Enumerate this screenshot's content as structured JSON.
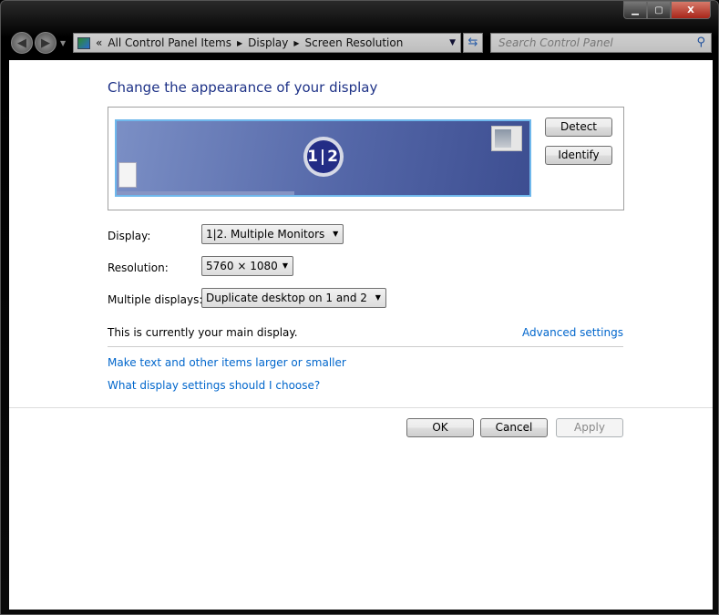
{
  "window": {
    "minimize_icon": "minimize-icon",
    "maximize_icon": "maximize-icon",
    "close_label": "X"
  },
  "address_bar": {
    "overflow": "«",
    "breadcrumbs": [
      "All Control Panel Items",
      "Display",
      "Screen Resolution"
    ]
  },
  "search": {
    "placeholder": "Search Control Panel"
  },
  "page": {
    "title": "Change the appearance of your display",
    "monitor_badge": "1|2",
    "detect": "Detect",
    "identify": "Identify",
    "display_label": "Display:",
    "display_value": "1|2. Multiple Monitors",
    "resolution_label": "Resolution:",
    "resolution_value": "5760 × 1080",
    "multiple_label": "Multiple displays:",
    "multiple_value": "Duplicate desktop on 1 and 2",
    "main_display_text": "This is currently your main display.",
    "advanced_link": "Advanced settings",
    "link_text_size": "Make text and other items larger or smaller",
    "link_which_settings": "What display settings should I choose?",
    "ok": "OK",
    "cancel": "Cancel",
    "apply": "Apply"
  }
}
